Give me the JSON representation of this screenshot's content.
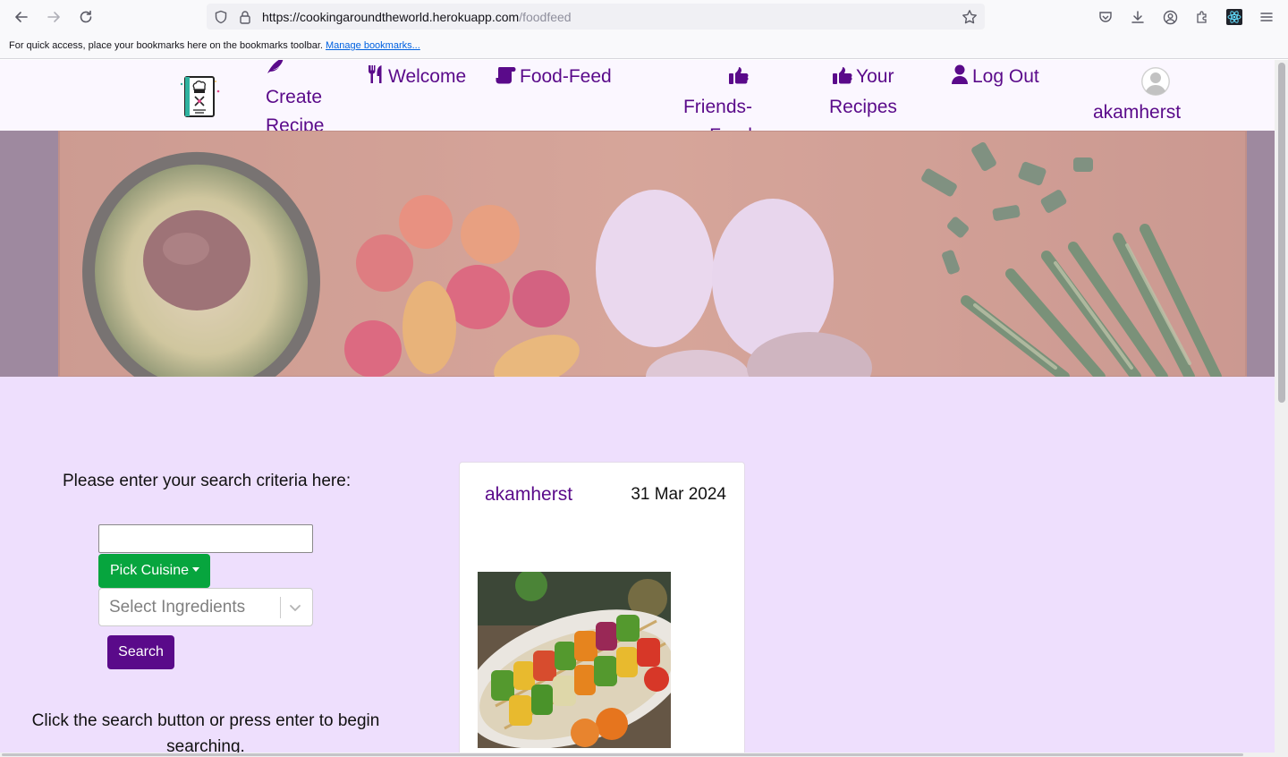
{
  "browser": {
    "url_host": "https://cookingaroundtheworld.herokuapp.com",
    "url_path": "/foodfeed",
    "bookmarks_text": "For quick access, place your bookmarks here on the bookmarks toolbar.",
    "bookmarks_link": "Manage bookmarks..."
  },
  "nav": {
    "create_line1": "Create",
    "create_line2": "Recipe",
    "welcome": "Welcome",
    "food_feed": "Food-Feed",
    "friends_line1": "Friends-",
    "friends_line2": "Feed",
    "your_line1": "Your",
    "your_line2": "Recipes",
    "logout": "Log Out",
    "username": "akamherst"
  },
  "search": {
    "title": "Please enter your search criteria here:",
    "input_value": "",
    "cuisine_label": "Pick Cuisine",
    "ingredients_placeholder": "Select Ingredients",
    "button_label": "Search",
    "help_text": "Click the search button or press enter to begin searching."
  },
  "feed": {
    "posts": [
      {
        "user": "akamherst",
        "date": "31 Mar 2024",
        "image": "vegetable-skewers"
      }
    ]
  },
  "colors": {
    "brand_purple": "#5a0a8a",
    "cuisine_green": "#07a53e",
    "page_bg": "#eedffd"
  }
}
